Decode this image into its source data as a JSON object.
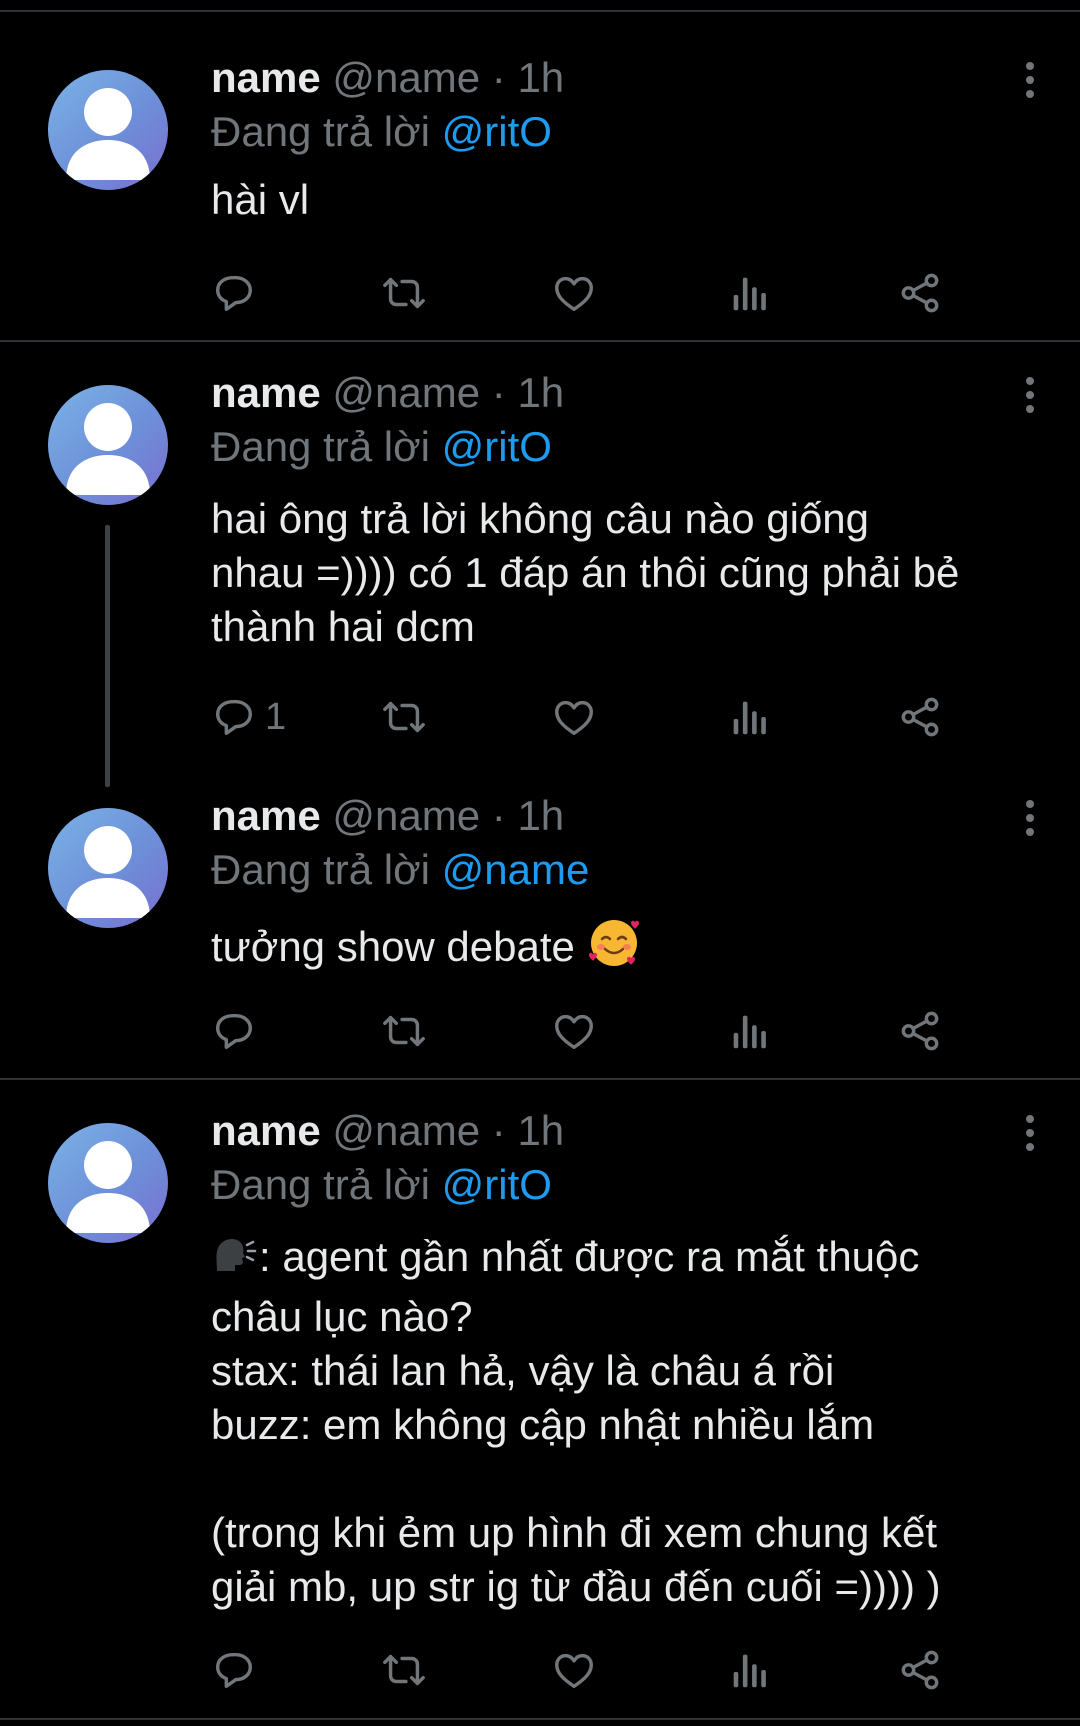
{
  "tweets": [
    {
      "name": "name",
      "handle": "@name",
      "separator": "·",
      "time": "1h",
      "reply_prefix": "Đang trả lời",
      "reply_to": "@ritO",
      "text": "hài vl",
      "reply_count": ""
    },
    {
      "name": "name",
      "handle": "@name",
      "separator": "·",
      "time": "1h",
      "reply_prefix": "Đang trả lời",
      "reply_to": "@ritO",
      "text": "hai ông trả lời không câu nào giống\nnhau =)))) có 1 đáp án thôi cũng phải bẻ\nthành hai dcm",
      "reply_count": "1"
    },
    {
      "name": "name",
      "handle": "@name",
      "separator": "·",
      "time": "1h",
      "reply_prefix": "Đang trả lời",
      "reply_to": "@name",
      "text": "tưởng show debate",
      "text_emoji": "smiling-face-with-hearts",
      "reply_count": ""
    },
    {
      "name": "name",
      "handle": "@name",
      "separator": "·",
      "time": "1h",
      "reply_prefix": "Đang trả lời",
      "reply_to": "@ritO",
      "text_emoji": "speaking-head",
      "text": ": agent gần nhất được ra mắt thuộc\nchâu lục nào?\nstax: thái lan hả, vậy là châu á rồi\nbuzz: em không cập nhật nhiều lắm\n\n(trong khi ẻm up hình đi xem chung kết\ngiải mb, up str ig từ đầu đến cuối =)))) )",
      "reply_count": ""
    }
  ],
  "colors": {
    "background": "#000000",
    "text": "#e7e9ea",
    "muted": "#71767b",
    "mention": "#1d9bf0",
    "divider": "#2f3336"
  },
  "icons": [
    "more-vertical-icon",
    "reply-icon",
    "retweet-icon",
    "like-icon",
    "views-icon",
    "share-icon"
  ]
}
